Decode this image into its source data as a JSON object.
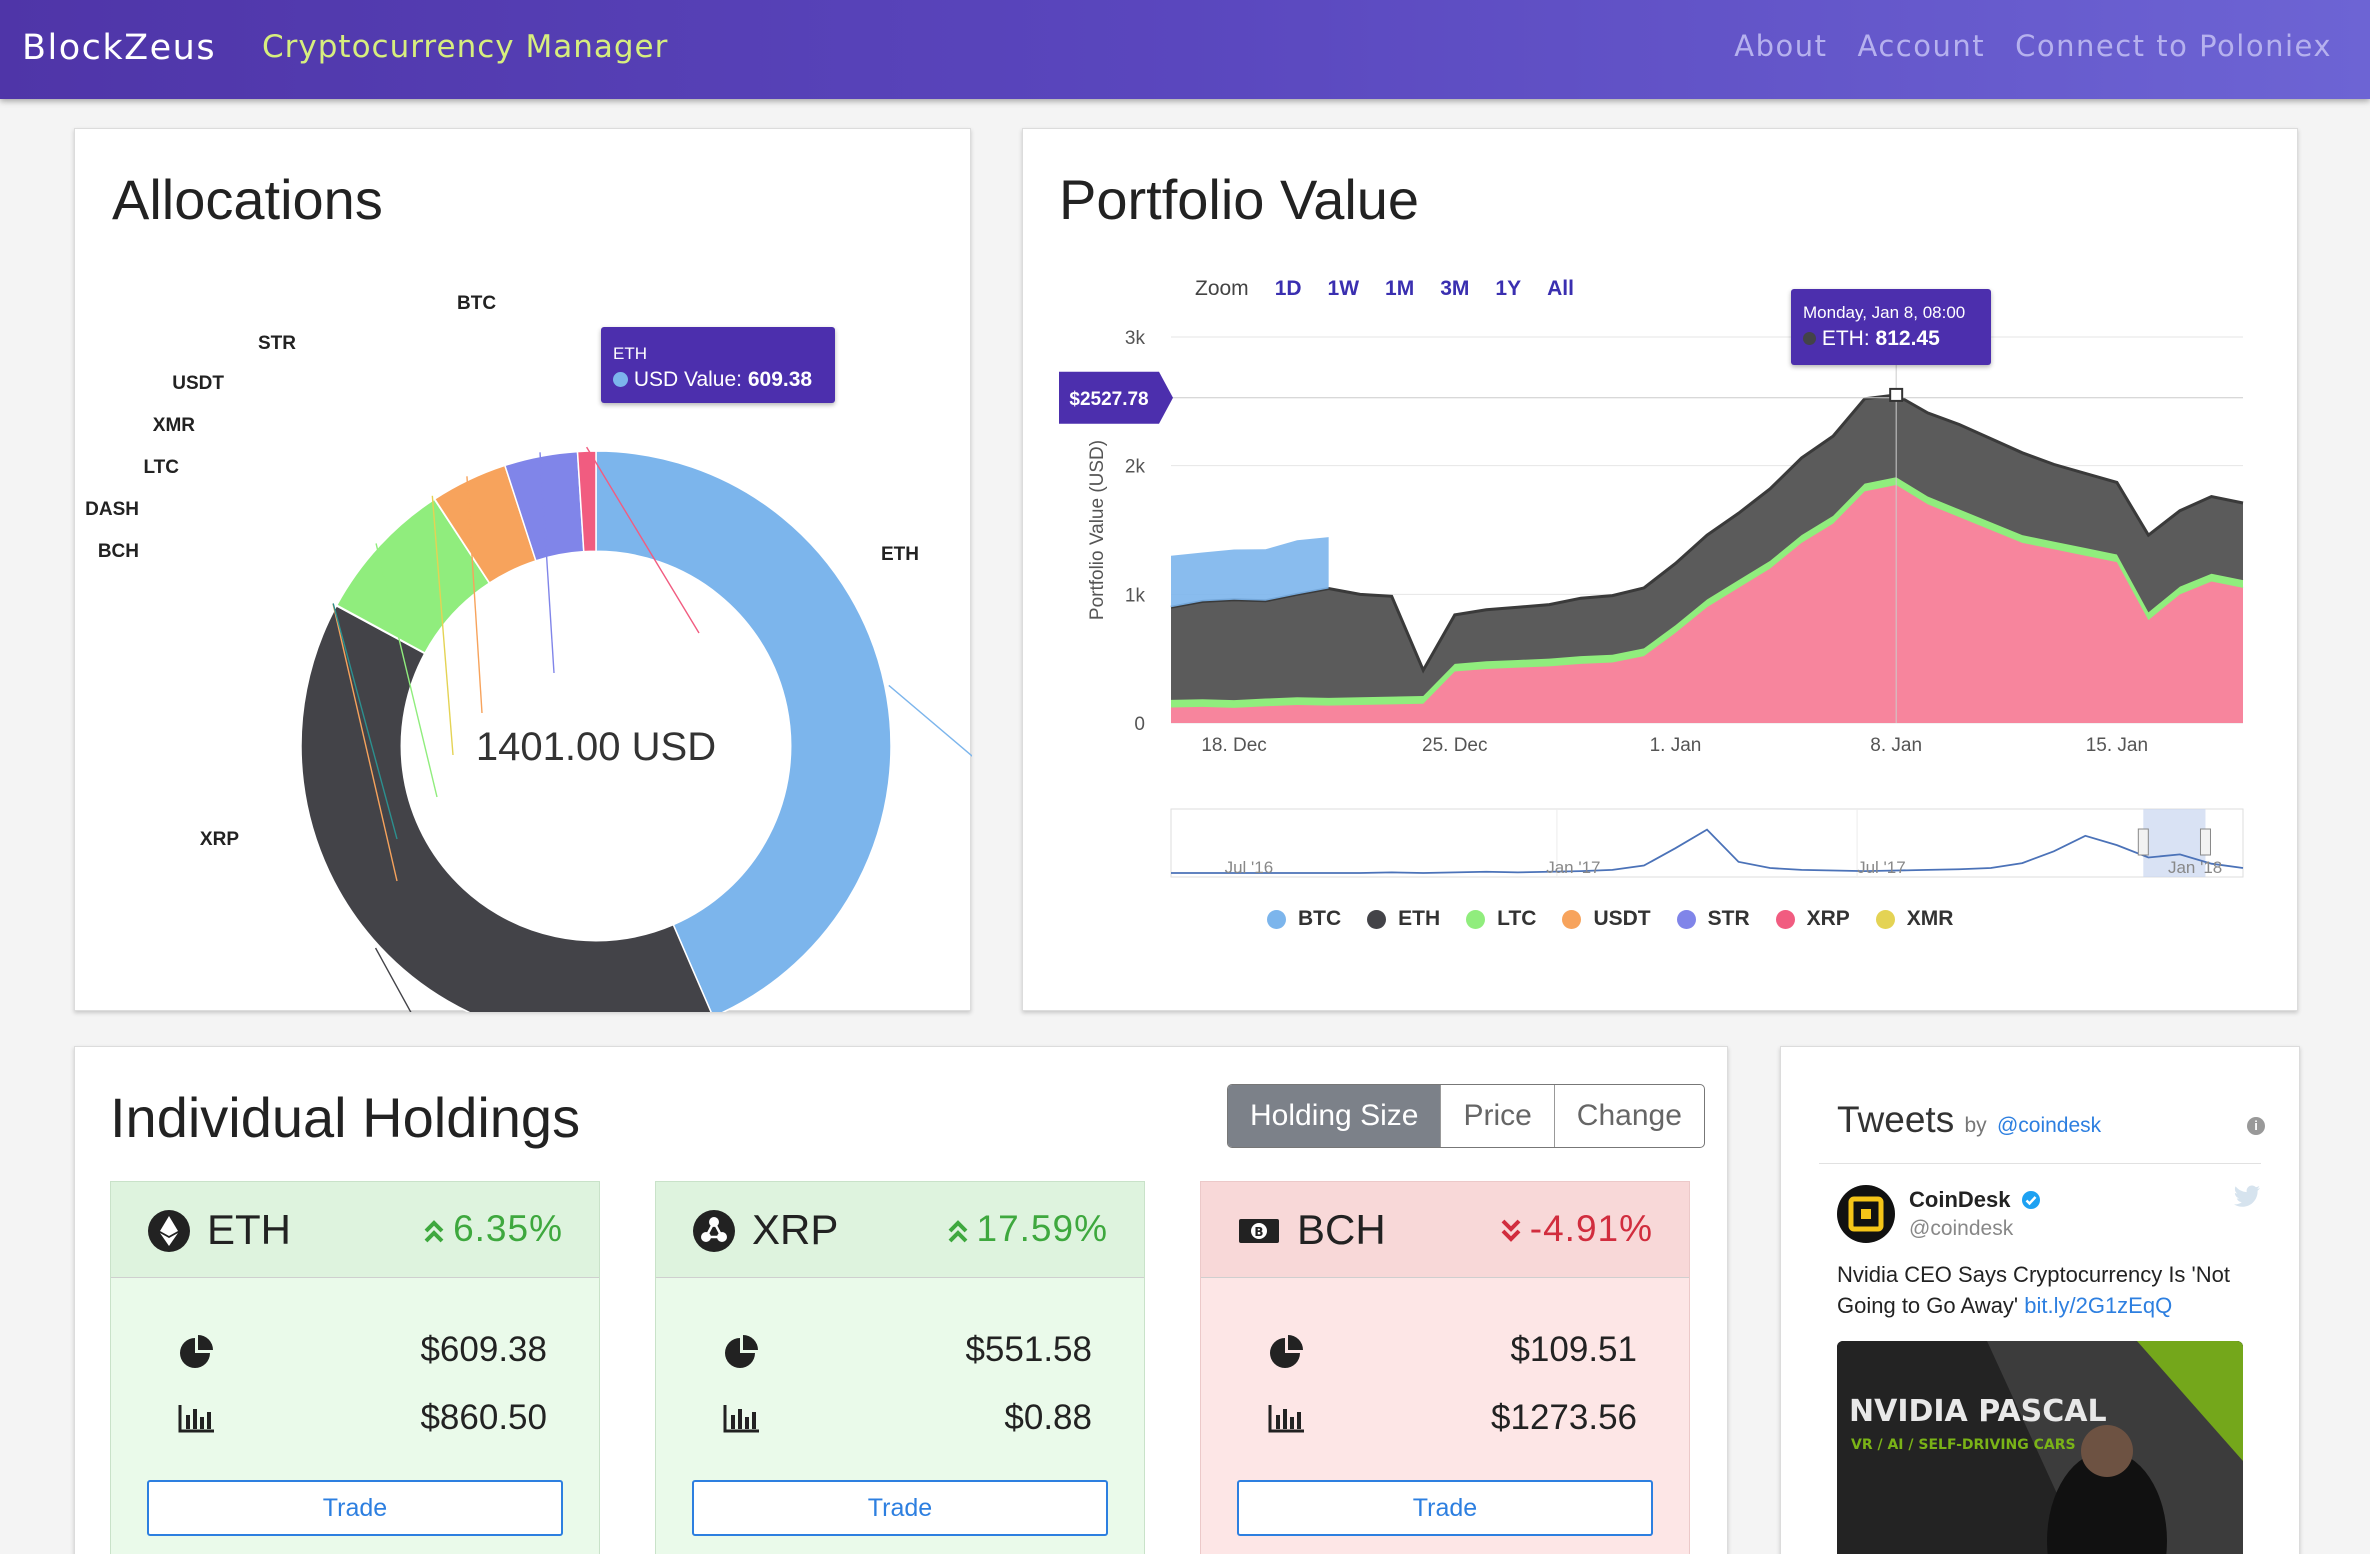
{
  "header": {
    "brand": "BlockZeus",
    "subtitle": "Cryptocurrency Manager",
    "nav": [
      "About",
      "Account",
      "Connect to Poloniex"
    ]
  },
  "allocations": {
    "title": "Allocations",
    "center_label": "1401.00 USD",
    "tooltip": {
      "coin": "ETH",
      "label": "USD Value:",
      "value": "609.38"
    },
    "chart_data": {
      "type": "pie",
      "title": "",
      "categories": [
        "ETH",
        "XRP",
        "BCH",
        "DASH",
        "LTC",
        "XMR",
        "USDT",
        "STR",
        "BTC"
      ],
      "values": [
        609.38,
        551.58,
        0.25,
        0.25,
        110.0,
        0.25,
        59.0,
        56.0,
        14.0
      ],
      "colors": [
        "#7cb5ec",
        "#434348",
        "#f7a35c",
        "#2b908f",
        "#90ed7d",
        "#e4d354",
        "#f7a35c",
        "#8085e9",
        "#f15c80"
      ],
      "inner_radius_fraction": 0.66,
      "center_text": "1401.00 USD"
    }
  },
  "portfolio": {
    "title": "Portfolio Value",
    "zoom_label": "Zoom",
    "zoom_buttons": [
      "1D",
      "1W",
      "1M",
      "3M",
      "1Y",
      "All"
    ],
    "crosshair_label": "$2527.78",
    "tooltip": {
      "date": "Monday, Jan 8, 08:00",
      "series": "ETH:",
      "value": "812.45"
    },
    "legend": [
      {
        "name": "BTC",
        "color": "#7cb5ec"
      },
      {
        "name": "ETH",
        "color": "#434348"
      },
      {
        "name": "LTC",
        "color": "#90ed7d"
      },
      {
        "name": "USDT",
        "color": "#f7a35c"
      },
      {
        "name": "STR",
        "color": "#8085e9"
      },
      {
        "name": "XRP",
        "color": "#f15c80"
      },
      {
        "name": "XMR",
        "color": "#e4d354"
      }
    ],
    "chart_data": {
      "type": "area",
      "title": "",
      "xlabel": "",
      "ylabel": "Portfolio Value (USD)",
      "ylim": [
        0,
        3000
      ],
      "yticks": [
        "0",
        "1k",
        "2k",
        "3k"
      ],
      "xticks": [
        "18. Dec",
        "25. Dec",
        "1. Jan",
        "8. Jan",
        "15. Jan"
      ],
      "navigator_ticks": [
        "Jul '16",
        "Jan '17",
        "Jul '17",
        "Jan '18"
      ],
      "x_dates": [
        "Dec 16",
        "Dec 17",
        "Dec 18",
        "Dec 19",
        "Dec 20",
        "Dec 21",
        "Dec 22",
        "Dec 23",
        "Dec 24",
        "Dec 25",
        "Dec 26",
        "Dec 27",
        "Dec 28",
        "Dec 29",
        "Dec 30",
        "Dec 31",
        "Jan 1",
        "Jan 2",
        "Jan 3",
        "Jan 4",
        "Jan 5",
        "Jan 6",
        "Jan 7",
        "Jan 8",
        "Jan 9",
        "Jan 10",
        "Jan 11",
        "Jan 12",
        "Jan 13",
        "Jan 14",
        "Jan 15",
        "Jan 16",
        "Jan 17",
        "Jan 18",
        "Jan 19"
      ],
      "series": [
        {
          "name": "XRP",
          "values": [
            120,
            125,
            118,
            130,
            140,
            135,
            140,
            145,
            150,
            400,
            420,
            430,
            440,
            460,
            470,
            520,
            700,
            900,
            1050,
            1200,
            1400,
            1550,
            1800,
            1850,
            1700,
            1600,
            1500,
            1400,
            1350,
            1300,
            1250,
            800,
            1000,
            1100,
            1050
          ]
        },
        {
          "name": "LTC",
          "values": [
            60,
            60,
            60,
            60,
            60,
            60,
            60,
            60,
            60,
            60,
            60,
            60,
            60,
            60,
            60,
            60,
            60,
            60,
            60,
            60,
            60,
            60,
            60,
            60,
            60,
            60,
            60,
            60,
            60,
            60,
            60,
            60,
            60,
            60,
            60
          ]
        },
        {
          "name": "ETH",
          "values": [
            720,
            760,
            780,
            760,
            800,
            850,
            800,
            780,
            200,
            380,
            400,
            410,
            420,
            450,
            460,
            470,
            480,
            500,
            520,
            560,
            600,
            620,
            660,
            640,
            650,
            660,
            650,
            640,
            600,
            580,
            560,
            600,
            590,
            600,
            600
          ]
        },
        {
          "name": "BTC",
          "values": [
            0,
            0,
            0,
            0,
            0,
            0,
            0,
            0,
            0,
            0,
            0,
            0,
            0,
            0,
            0,
            0,
            0,
            0,
            0,
            0,
            0,
            0,
            0,
            0,
            0,
            0,
            0,
            0,
            0,
            0,
            0,
            0,
            0,
            0,
            0
          ]
        }
      ],
      "btc_early_values": [
        400,
        380,
        390,
        400,
        420,
        400
      ]
    }
  },
  "holdings": {
    "title": "Individual Holdings",
    "sort_buttons": [
      "Holding Size",
      "Price",
      "Change"
    ],
    "trade_label": "Trade",
    "cards": [
      {
        "coin": "ETH",
        "change": "6.35%",
        "direction": "up",
        "holding": "$609.38",
        "price": "$860.50"
      },
      {
        "coin": "XRP",
        "change": "17.59%",
        "direction": "up",
        "holding": "$551.58",
        "price": "$0.88"
      },
      {
        "coin": "BCH",
        "change": "-4.91%",
        "direction": "down",
        "holding": "$109.51",
        "price": "$1273.56"
      }
    ]
  },
  "tweets": {
    "title": "Tweets",
    "by": "by",
    "handle": "@coindesk",
    "tweet": {
      "name": "CoinDesk",
      "user": "@coindesk",
      "text": "Nvidia CEO Says Cryptocurrency Is 'Not Going to Go Away'",
      "link": "bit.ly/2G1zEqQ",
      "image_text_1": "NVIDIA PASCAL",
      "image_text_2": "VR / AI / SELF-DRIVING CARS"
    }
  }
}
